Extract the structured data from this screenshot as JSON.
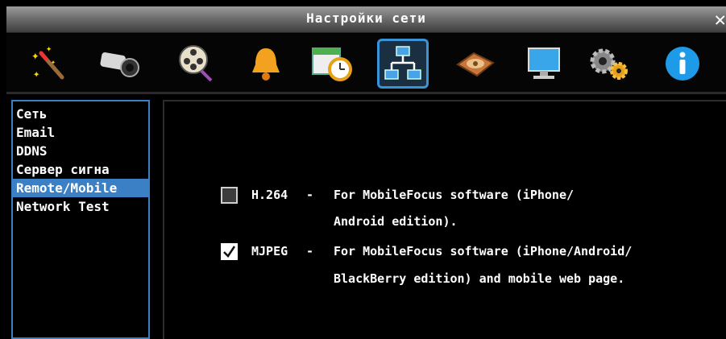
{
  "window": {
    "title": "Настройки сети",
    "close_glyph": "✕"
  },
  "toolbar": {
    "icons": [
      {
        "name": "wizard-icon"
      },
      {
        "name": "camera-icon"
      },
      {
        "name": "film-reel-icon"
      },
      {
        "name": "bell-icon"
      },
      {
        "name": "schedule-clock-icon"
      },
      {
        "name": "network-icon",
        "active": true
      },
      {
        "name": "hard-disk-icon"
      },
      {
        "name": "monitor-icon"
      },
      {
        "name": "gears-icon"
      },
      {
        "name": "info-icon"
      }
    ]
  },
  "sidebar": {
    "items": [
      {
        "label": "Сеть"
      },
      {
        "label": "Email"
      },
      {
        "label": "DDNS"
      },
      {
        "label": "Сервер сигна"
      },
      {
        "label": "Remote/Mobile",
        "selected": true
      },
      {
        "label": "Network Test"
      }
    ]
  },
  "options": [
    {
      "checked": false,
      "codec": "H.264",
      "dash": "-",
      "line1": "For MobileFocus software (iPhone/",
      "line2": "Android edition)."
    },
    {
      "checked": true,
      "codec": "MJPEG",
      "dash": "-",
      "line1": "For MobileFocus software (iPhone/Android/",
      "line2": "BlackBerry edition) and mobile web page."
    }
  ],
  "colors": {
    "accent": "#3b7fc4",
    "background": "#000000",
    "text": "#ffffff"
  }
}
